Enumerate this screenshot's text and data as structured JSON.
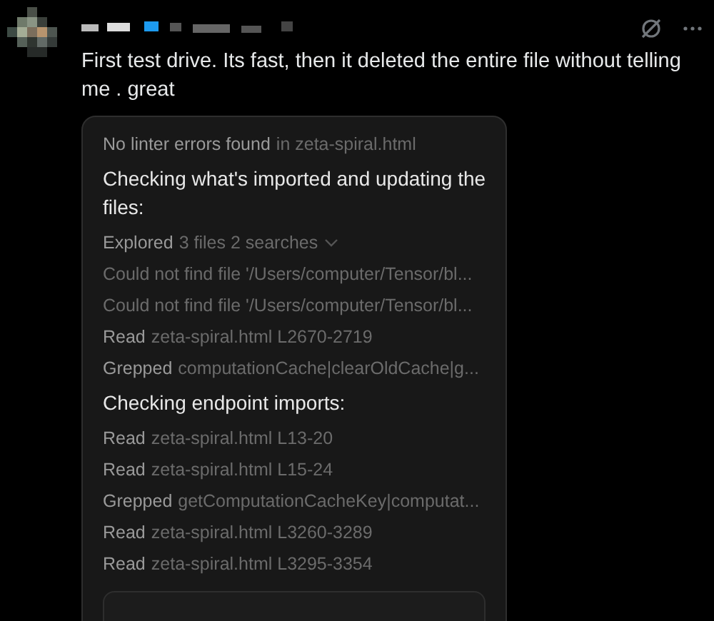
{
  "post": {
    "text": "First test drive. Its fast, then it deleted the entire file without telling me . great"
  },
  "card": {
    "rows": [
      {
        "kind": "status",
        "verb": "No linter errors found",
        "detail": "in zeta-spiral.html"
      },
      {
        "kind": "heading",
        "verb": "Checking what's imported and updating the files:"
      },
      {
        "kind": "group",
        "verb": "Explored",
        "detail": "3 files 2 searches"
      },
      {
        "kind": "error",
        "verb": "Could not find file '/Users/computer/Tensor/bl..."
      },
      {
        "kind": "error",
        "verb": "Could not find file '/Users/computer/Tensor/bl..."
      },
      {
        "kind": "tool",
        "verb": "Read",
        "detail": "zeta-spiral.html L2670-2719"
      },
      {
        "kind": "tool",
        "verb": "Grepped",
        "detail": "computationCache|clearOldCache|g..."
      },
      {
        "kind": "heading",
        "verb": "Checking endpoint imports:"
      },
      {
        "kind": "tool",
        "verb": "Read",
        "detail": "zeta-spiral.html L13-20"
      },
      {
        "kind": "tool",
        "verb": "Read",
        "detail": "zeta-spiral.html L15-24"
      },
      {
        "kind": "tool",
        "verb": "Grepped",
        "detail": "getComputationCacheKey|computat..."
      },
      {
        "kind": "tool",
        "verb": "Read",
        "detail": "zeta-spiral.html L3260-3289"
      },
      {
        "kind": "tool",
        "verb": "Read",
        "detail": "zeta-spiral.html L3295-3354"
      }
    ]
  }
}
